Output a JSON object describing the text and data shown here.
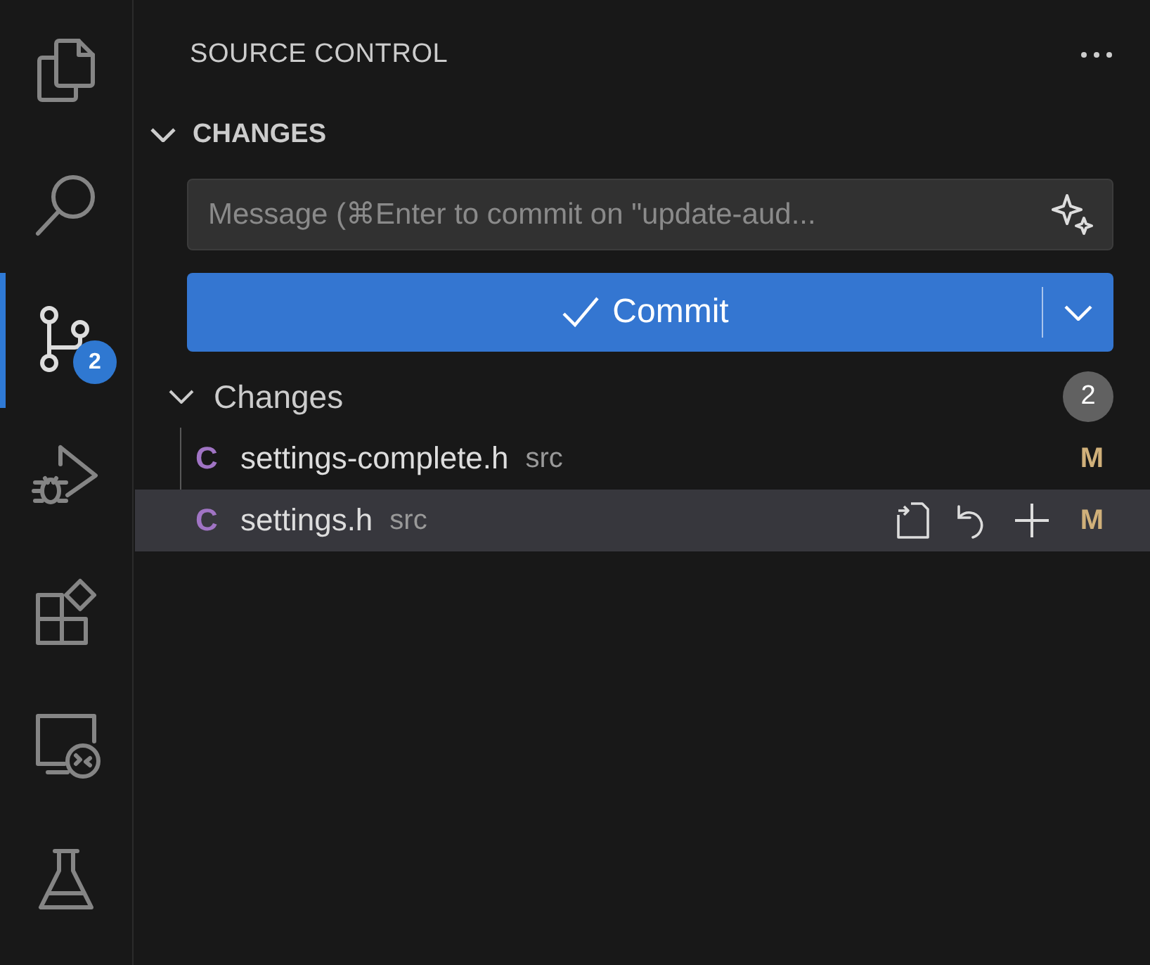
{
  "activity_bar": {
    "items": [
      {
        "kind": "explorer",
        "selected": false
      },
      {
        "kind": "search",
        "selected": false
      },
      {
        "kind": "source_control",
        "selected": true,
        "badge": "2"
      },
      {
        "kind": "run_debug",
        "selected": false
      },
      {
        "kind": "extensions",
        "selected": false
      },
      {
        "kind": "remote",
        "selected": false
      },
      {
        "kind": "testing",
        "selected": false
      }
    ]
  },
  "panel": {
    "title": "SOURCE CONTROL",
    "section": {
      "title": "CHANGES",
      "expanded": true
    },
    "message": {
      "placeholder": "Message (⌘Enter to commit on \"update-aud..."
    },
    "commit_button": {
      "label": "Commit"
    },
    "group": {
      "label": "Changes",
      "count": "2",
      "expanded": true,
      "files": [
        {
          "type_letter": "C",
          "name": "settings-complete.h",
          "folder": "src",
          "status": "M",
          "selected": false
        },
        {
          "type_letter": "C",
          "name": "settings.h",
          "folder": "src",
          "status": "M",
          "selected": true
        }
      ]
    }
  }
}
